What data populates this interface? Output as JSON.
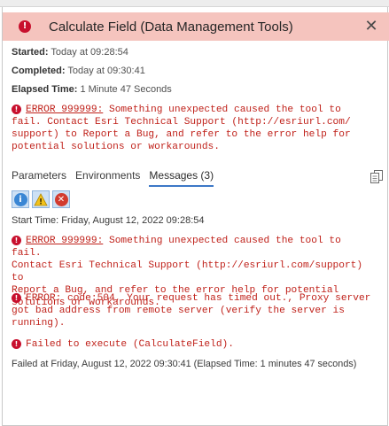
{
  "background_strip": {
    "ghost_text": ""
  },
  "window": {
    "title": "Calculate Field (Data Management Tools)",
    "close_glyph": "✕",
    "header_color": "#f5c4be"
  },
  "summary": {
    "started_label": "Started:",
    "started_value": "Today at 09:28:54",
    "completed_label": "Completed:",
    "completed_value": "Today at 09:30:41",
    "elapsed_label": "Elapsed Time:",
    "elapsed_value": "1 Minute 47 Seconds",
    "error_code": "ERROR 999999:",
    "error_lines": [
      "Something unexpected caused the tool to",
      "fail. Contact Esri Technical Support (http://esriurl.com/",
      "support) to Report a Bug, and refer to the error help for",
      "potential solutions or workarounds."
    ]
  },
  "tabs": {
    "parameters": "Parameters",
    "environments": "Environments",
    "messages": "Messages (3)"
  },
  "filters": {
    "info_icon": "info-icon",
    "warning_icon": "warning-icon",
    "error_icon": "error-icon"
  },
  "messages": {
    "start_time": "Start Time: Friday, August 12, 2022 09:28:54",
    "error1_code": "ERROR 999999:",
    "error1_lines": [
      "Something unexpected caused the tool to fail.",
      "Contact Esri Technical Support (http://esriurl.com/support) to",
      "Report a Bug, and refer to the error help for potential",
      "solutions or workarounds."
    ],
    "error2_lines": [
      "ERROR: code:504, Your request has timed out., Proxy server",
      "got bad address from remote server (verify the server is",
      "running)."
    ],
    "error3": "Failed to execute (CalculateField).",
    "failed_at": "Failed at Friday, August 12, 2022 09:30:41 (Elapsed Time: 1 minutes 47 seconds)"
  },
  "colors": {
    "error_red": "#c0221b",
    "tab_underline": "#3d78c7"
  }
}
